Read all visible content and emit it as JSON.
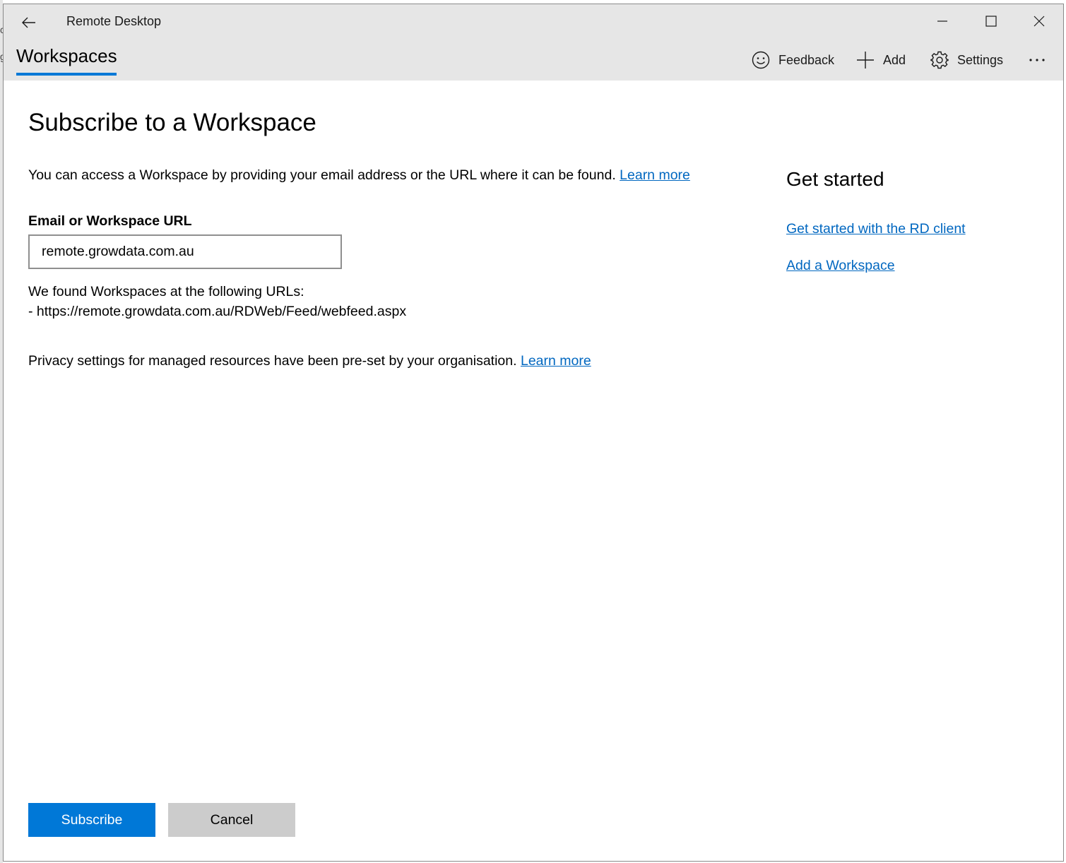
{
  "window": {
    "title": "Remote Desktop",
    "controls": {
      "minimize_icon": "minimize-icon",
      "maximize_icon": "maximize-icon",
      "close_icon": "close-icon"
    }
  },
  "header": {
    "back_icon": "back-arrow-icon",
    "active_tab": "Workspaces",
    "commands": [
      {
        "label": "Feedback",
        "icon": "smiley-icon"
      },
      {
        "label": "Add",
        "icon": "plus-icon"
      },
      {
        "label": "Settings",
        "icon": "gear-icon"
      }
    ],
    "more_icon": "more-ellipsis-icon"
  },
  "main": {
    "title": "Subscribe to a Workspace",
    "description": "You can access a Workspace by providing your email address or the URL where it can be found.",
    "description_link": "Learn more",
    "field_label": "Email or Workspace URL",
    "field_value": "remote.growdata.com.au",
    "found_title": "We found Workspaces at the following URLs:",
    "found_url": "- https://remote.growdata.com.au/RDWeb/Feed/webfeed.aspx",
    "privacy_text": "Privacy settings for managed resources have been pre-set by your organisation.",
    "privacy_link": "Learn more"
  },
  "sidebar": {
    "heading": "Get started",
    "links": [
      "Get started with the RD client",
      "Add a Workspace"
    ]
  },
  "footer": {
    "subscribe_label": "Subscribe",
    "cancel_label": "Cancel"
  },
  "colors": {
    "accent": "#0078d7",
    "link": "#0067c0",
    "titlebar_bg": "#e6e6e6",
    "cancel_bg": "#cccccc"
  }
}
